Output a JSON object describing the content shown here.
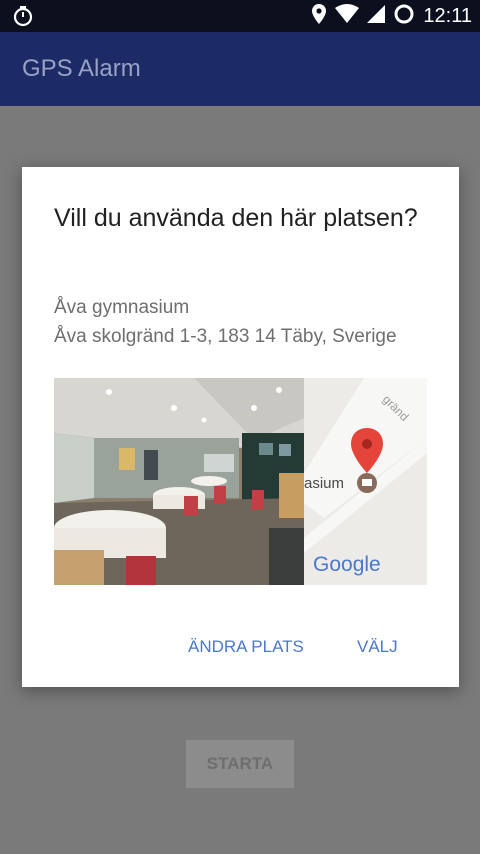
{
  "status_bar": {
    "time": "12:11",
    "icons": [
      "stopwatch-icon",
      "location-icon",
      "wifi-icon",
      "signal-icon",
      "battery-icon"
    ]
  },
  "app_bar": {
    "title": "GPS Alarm"
  },
  "dialog": {
    "heading": "Vill du använda den här platsen?",
    "place_name": "Åva gymnasium",
    "place_address": "Åva skolgränd 1-3, 183 14 Täby, Sverige",
    "map_label": "asium",
    "map_street": "gränd",
    "map_logo": "Google",
    "buttons": {
      "change": "ÄNDRA PLATS",
      "select": "VÄLJ"
    }
  },
  "main": {
    "start_button": "STARTA"
  },
  "colors": {
    "app_bar": "#1c2a66",
    "status_bar": "#0b0f1e",
    "scrim": "#7a7a7a",
    "accent": "#4a78d1"
  }
}
